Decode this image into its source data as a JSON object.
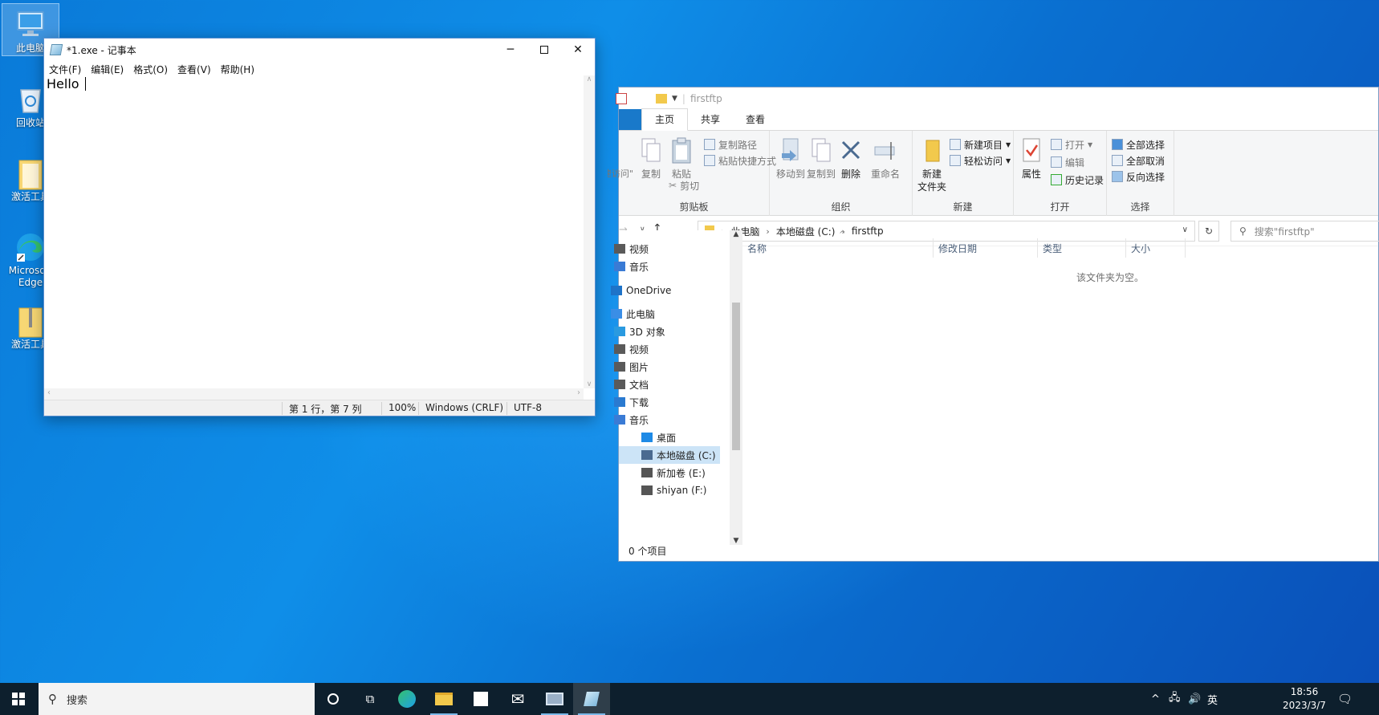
{
  "desktop": {
    "icons": [
      {
        "label": "此电脑"
      },
      {
        "label": "回收站"
      },
      {
        "label": "激活工具"
      },
      {
        "label": "Microsoft Edge"
      },
      {
        "label": "激活工具"
      }
    ]
  },
  "notepad": {
    "title": "*1.exe - 记事本",
    "menu": [
      "文件(F)",
      "编辑(E)",
      "格式(O)",
      "查看(V)",
      "帮助(H)"
    ],
    "content": "Hello ",
    "status": {
      "position": "第 1 行，第 7 列",
      "zoom": "100%",
      "line_ending": "Windows (CRLF)",
      "encoding": "UTF-8"
    }
  },
  "explorer": {
    "title": "firstftp",
    "tabs": [
      "主页",
      "共享",
      "查看"
    ],
    "ribbon": {
      "clipboard": {
        "group": "剪贴板",
        "pin_quick_access": "固定到\"快速访问\"",
        "copy": "复制",
        "paste": "粘贴",
        "copy_path": "复制路径",
        "paste_shortcut": "粘贴快捷方式",
        "cut": "剪切"
      },
      "organize": {
        "group": "组织",
        "move_to": "移动到",
        "copy_to": "复制到",
        "delete": "删除",
        "rename": "重命名"
      },
      "new": {
        "group": "新建",
        "new_folder_line1": "新建",
        "new_folder_line2": "文件夹",
        "new_item": "新建项目",
        "easy_access": "轻松访问"
      },
      "open": {
        "group": "打开",
        "properties": "属性",
        "open": "打开",
        "edit": "编辑",
        "history": "历史记录"
      },
      "select": {
        "group": "选择",
        "select_all": "全部选择",
        "select_none": "全部取消",
        "invert": "反向选择"
      }
    },
    "breadcrumb": [
      "此电脑",
      "本地磁盘 (C:)",
      "firstftp"
    ],
    "search_placeholder": "搜索\"firstftp\"",
    "nav": [
      {
        "label": "视频",
        "color": "#5a5a5a"
      },
      {
        "label": "音乐",
        "color": "#3a7bd5"
      },
      {
        "label": "OneDrive",
        "color": "#1e73c8"
      },
      {
        "label": "此电脑",
        "color": "#3a8ee6"
      },
      {
        "label": "3D 对象",
        "color": "#2a9ae0"
      },
      {
        "label": "视频",
        "color": "#5a5a5a"
      },
      {
        "label": "图片",
        "color": "#5a5a5a"
      },
      {
        "label": "文档",
        "color": "#5a5a5a"
      },
      {
        "label": "下载",
        "color": "#2a7ad0"
      },
      {
        "label": "音乐",
        "color": "#3a7bd5"
      },
      {
        "label": "桌面",
        "color": "#1e8ae6"
      },
      {
        "label": "本地磁盘 (C:)",
        "color": "#4a6a90"
      },
      {
        "label": "新加卷 (E:)",
        "color": "#555555"
      },
      {
        "label": "shiyan (F:)",
        "color": "#555555"
      }
    ],
    "columns": [
      "名称",
      "修改日期",
      "类型",
      "大小"
    ],
    "empty_message": "该文件夹为空。",
    "status": "0 个项目"
  },
  "taskbar": {
    "search_label": "搜索",
    "ime": "英",
    "time": "18:56",
    "date": "2023/3/7"
  },
  "colors": {
    "accent": "#1979ca",
    "selection": "#cce4f7",
    "taskbar": "#0d1f2d"
  }
}
